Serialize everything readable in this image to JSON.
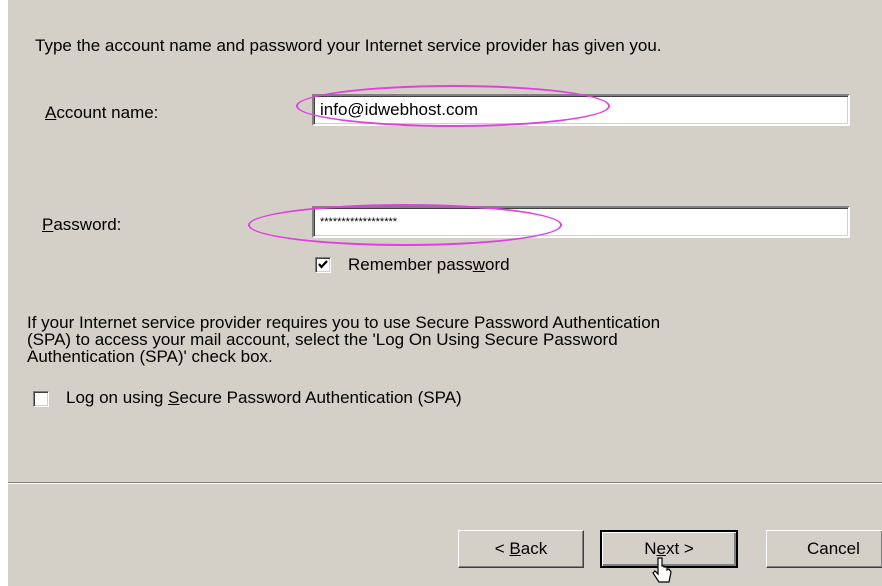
{
  "intro_text": "Type the account name and password your Internet service provider has given you.",
  "account": {
    "label_first": "A",
    "label_rest": "ccount name:",
    "value": "info@idwebhost.com"
  },
  "password": {
    "label_first": "P",
    "label_rest": "assword:",
    "value": "******************"
  },
  "remember": {
    "label_before": "Remember pass",
    "label_underlined": "w",
    "label_after": "ord",
    "checked": true
  },
  "spa_info": "If your Internet service provider requires you to use Secure Password Authentication\n(SPA) to access your mail account, select the 'Log On Using Secure Password\nAuthentication (SPA)' check box.",
  "spa_checkbox": {
    "label_before": "Log on using ",
    "label_underlined": "S",
    "label_after": "ecure Password Authentication (SPA)",
    "checked": false
  },
  "buttons": {
    "back_prefix": "< ",
    "back_underlined": "B",
    "back_rest": "ack",
    "next_prefix": "N",
    "next_underlined": "e",
    "next_rest": "xt >",
    "cancel": "Cancel"
  },
  "colors": {
    "dialog_bg": "#d4d0c8",
    "highlight_ellipse": "#e040e0"
  },
  "icons": [
    "checkmark-icon",
    "mouse-pointer-icon"
  ]
}
